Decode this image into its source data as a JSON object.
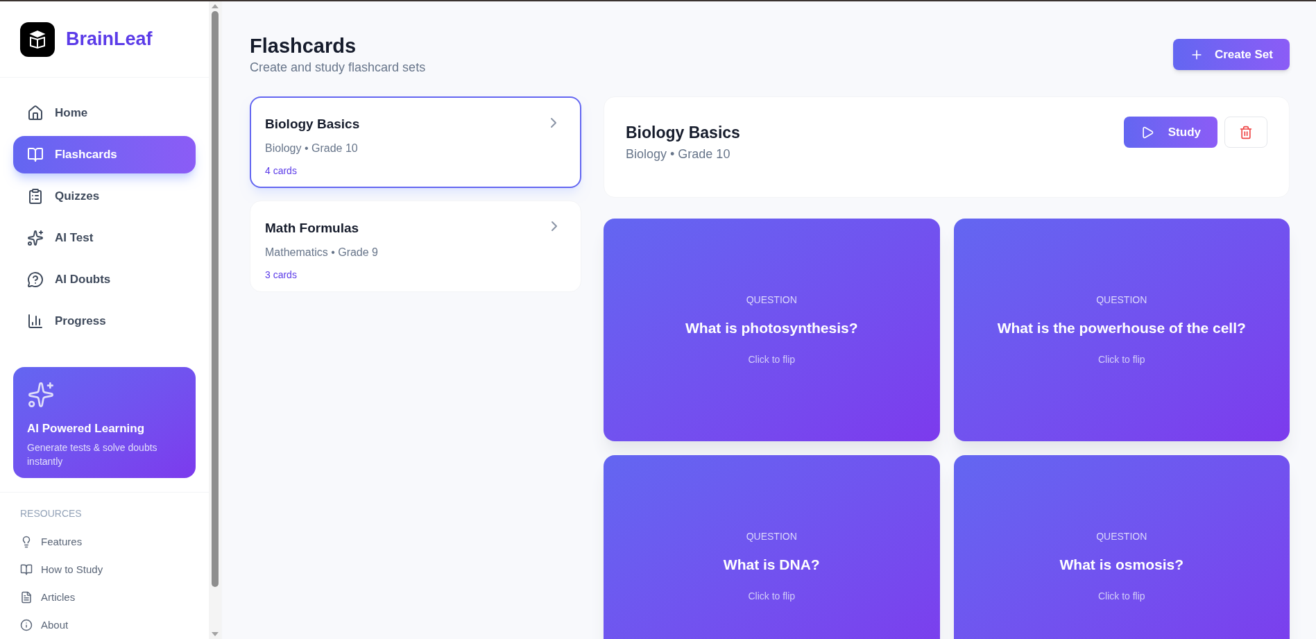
{
  "app": {
    "name": "BrainLeaf"
  },
  "nav": [
    {
      "label": "Home",
      "selected": false
    },
    {
      "label": "Flashcards",
      "selected": true
    },
    {
      "label": "Quizzes",
      "selected": false
    },
    {
      "label": "AI Test",
      "selected": false
    },
    {
      "label": "AI Doubts",
      "selected": false
    },
    {
      "label": "Progress",
      "selected": false
    }
  ],
  "promo": {
    "title": "AI Powered Learning",
    "text": "Generate tests & solve doubts instantly"
  },
  "resources": {
    "heading": "RESOURCES",
    "items": [
      {
        "label": "Features"
      },
      {
        "label": "How to Study"
      },
      {
        "label": "Articles"
      },
      {
        "label": "About"
      }
    ]
  },
  "page": {
    "title": "Flashcards",
    "subtitle": "Create and study flashcard sets",
    "create_button": "Create Set"
  },
  "sets": [
    {
      "title": "Biology Basics",
      "meta": "Biology • Grade 10",
      "count": "4 cards",
      "selected": true
    },
    {
      "title": "Math Formulas",
      "meta": "Mathematics • Grade 9",
      "count": "3 cards",
      "selected": false
    }
  ],
  "detail": {
    "title": "Biology Basics",
    "meta": "Biology • Grade 10",
    "study_button": "Study"
  },
  "cards": [
    {
      "label": "QUESTION",
      "text": "What is photosynthesis?",
      "hint": "Click to flip"
    },
    {
      "label": "QUESTION",
      "text": "What is the powerhouse of the cell?",
      "hint": "Click to flip"
    },
    {
      "label": "QUESTION",
      "text": "What is DNA?",
      "hint": "Click to flip"
    },
    {
      "label": "QUESTION",
      "text": "What is osmosis?",
      "hint": "Click to flip"
    }
  ]
}
